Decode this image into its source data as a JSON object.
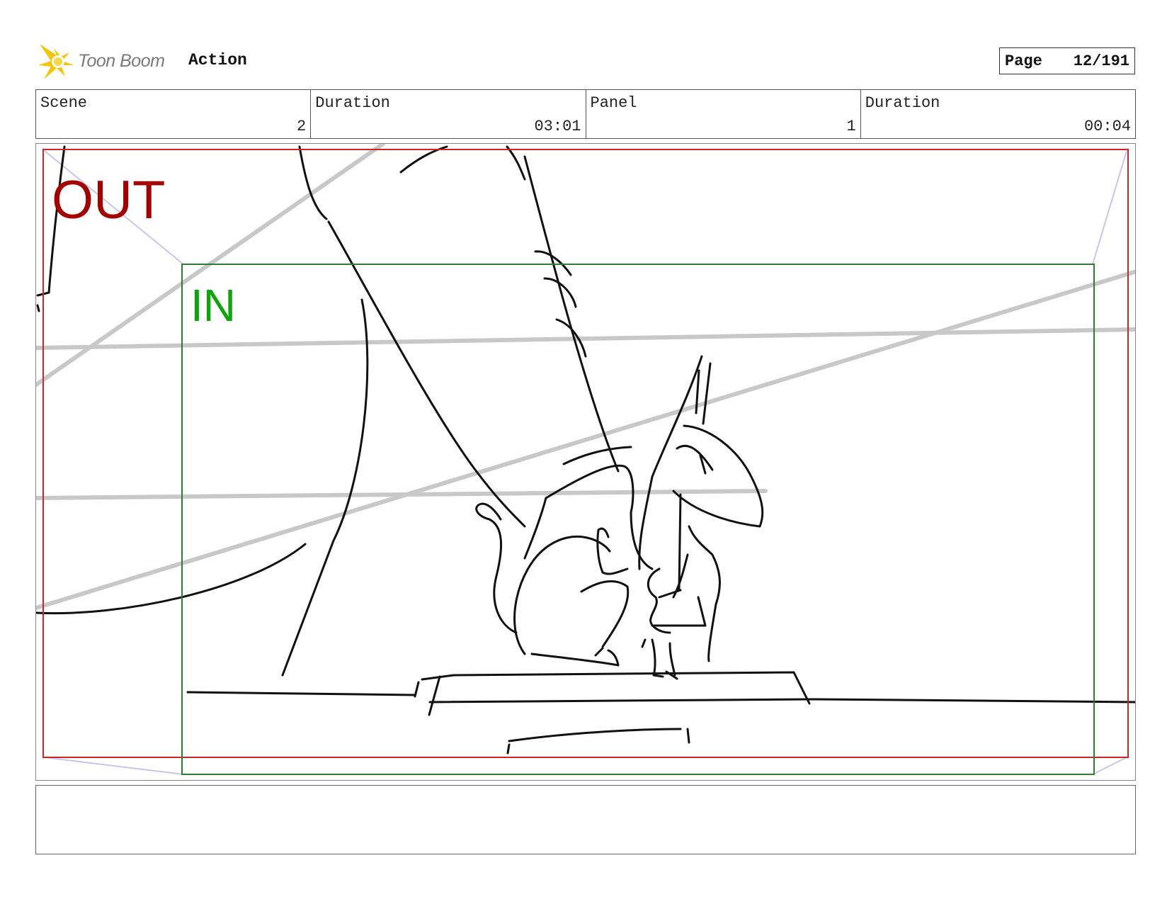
{
  "header": {
    "brand": "Toon Boom",
    "product": "Action",
    "page_label": "Page",
    "page_value": "12/191"
  },
  "info": {
    "scene_label": "Scene",
    "scene_value": "2",
    "scene_duration_label": "Duration",
    "scene_duration_value": "03:01",
    "panel_label": "Panel",
    "panel_value": "1",
    "panel_duration_label": "Duration",
    "panel_duration_value": "00:04"
  },
  "frame": {
    "out_label": "OUT",
    "in_label": "IN",
    "out_color": "#a50000",
    "in_color": "#0aa60a",
    "out_frame_color": "#c62828",
    "in_frame_color": "#2e7d32"
  },
  "icons": {
    "logo": "starburst-logo-icon"
  }
}
